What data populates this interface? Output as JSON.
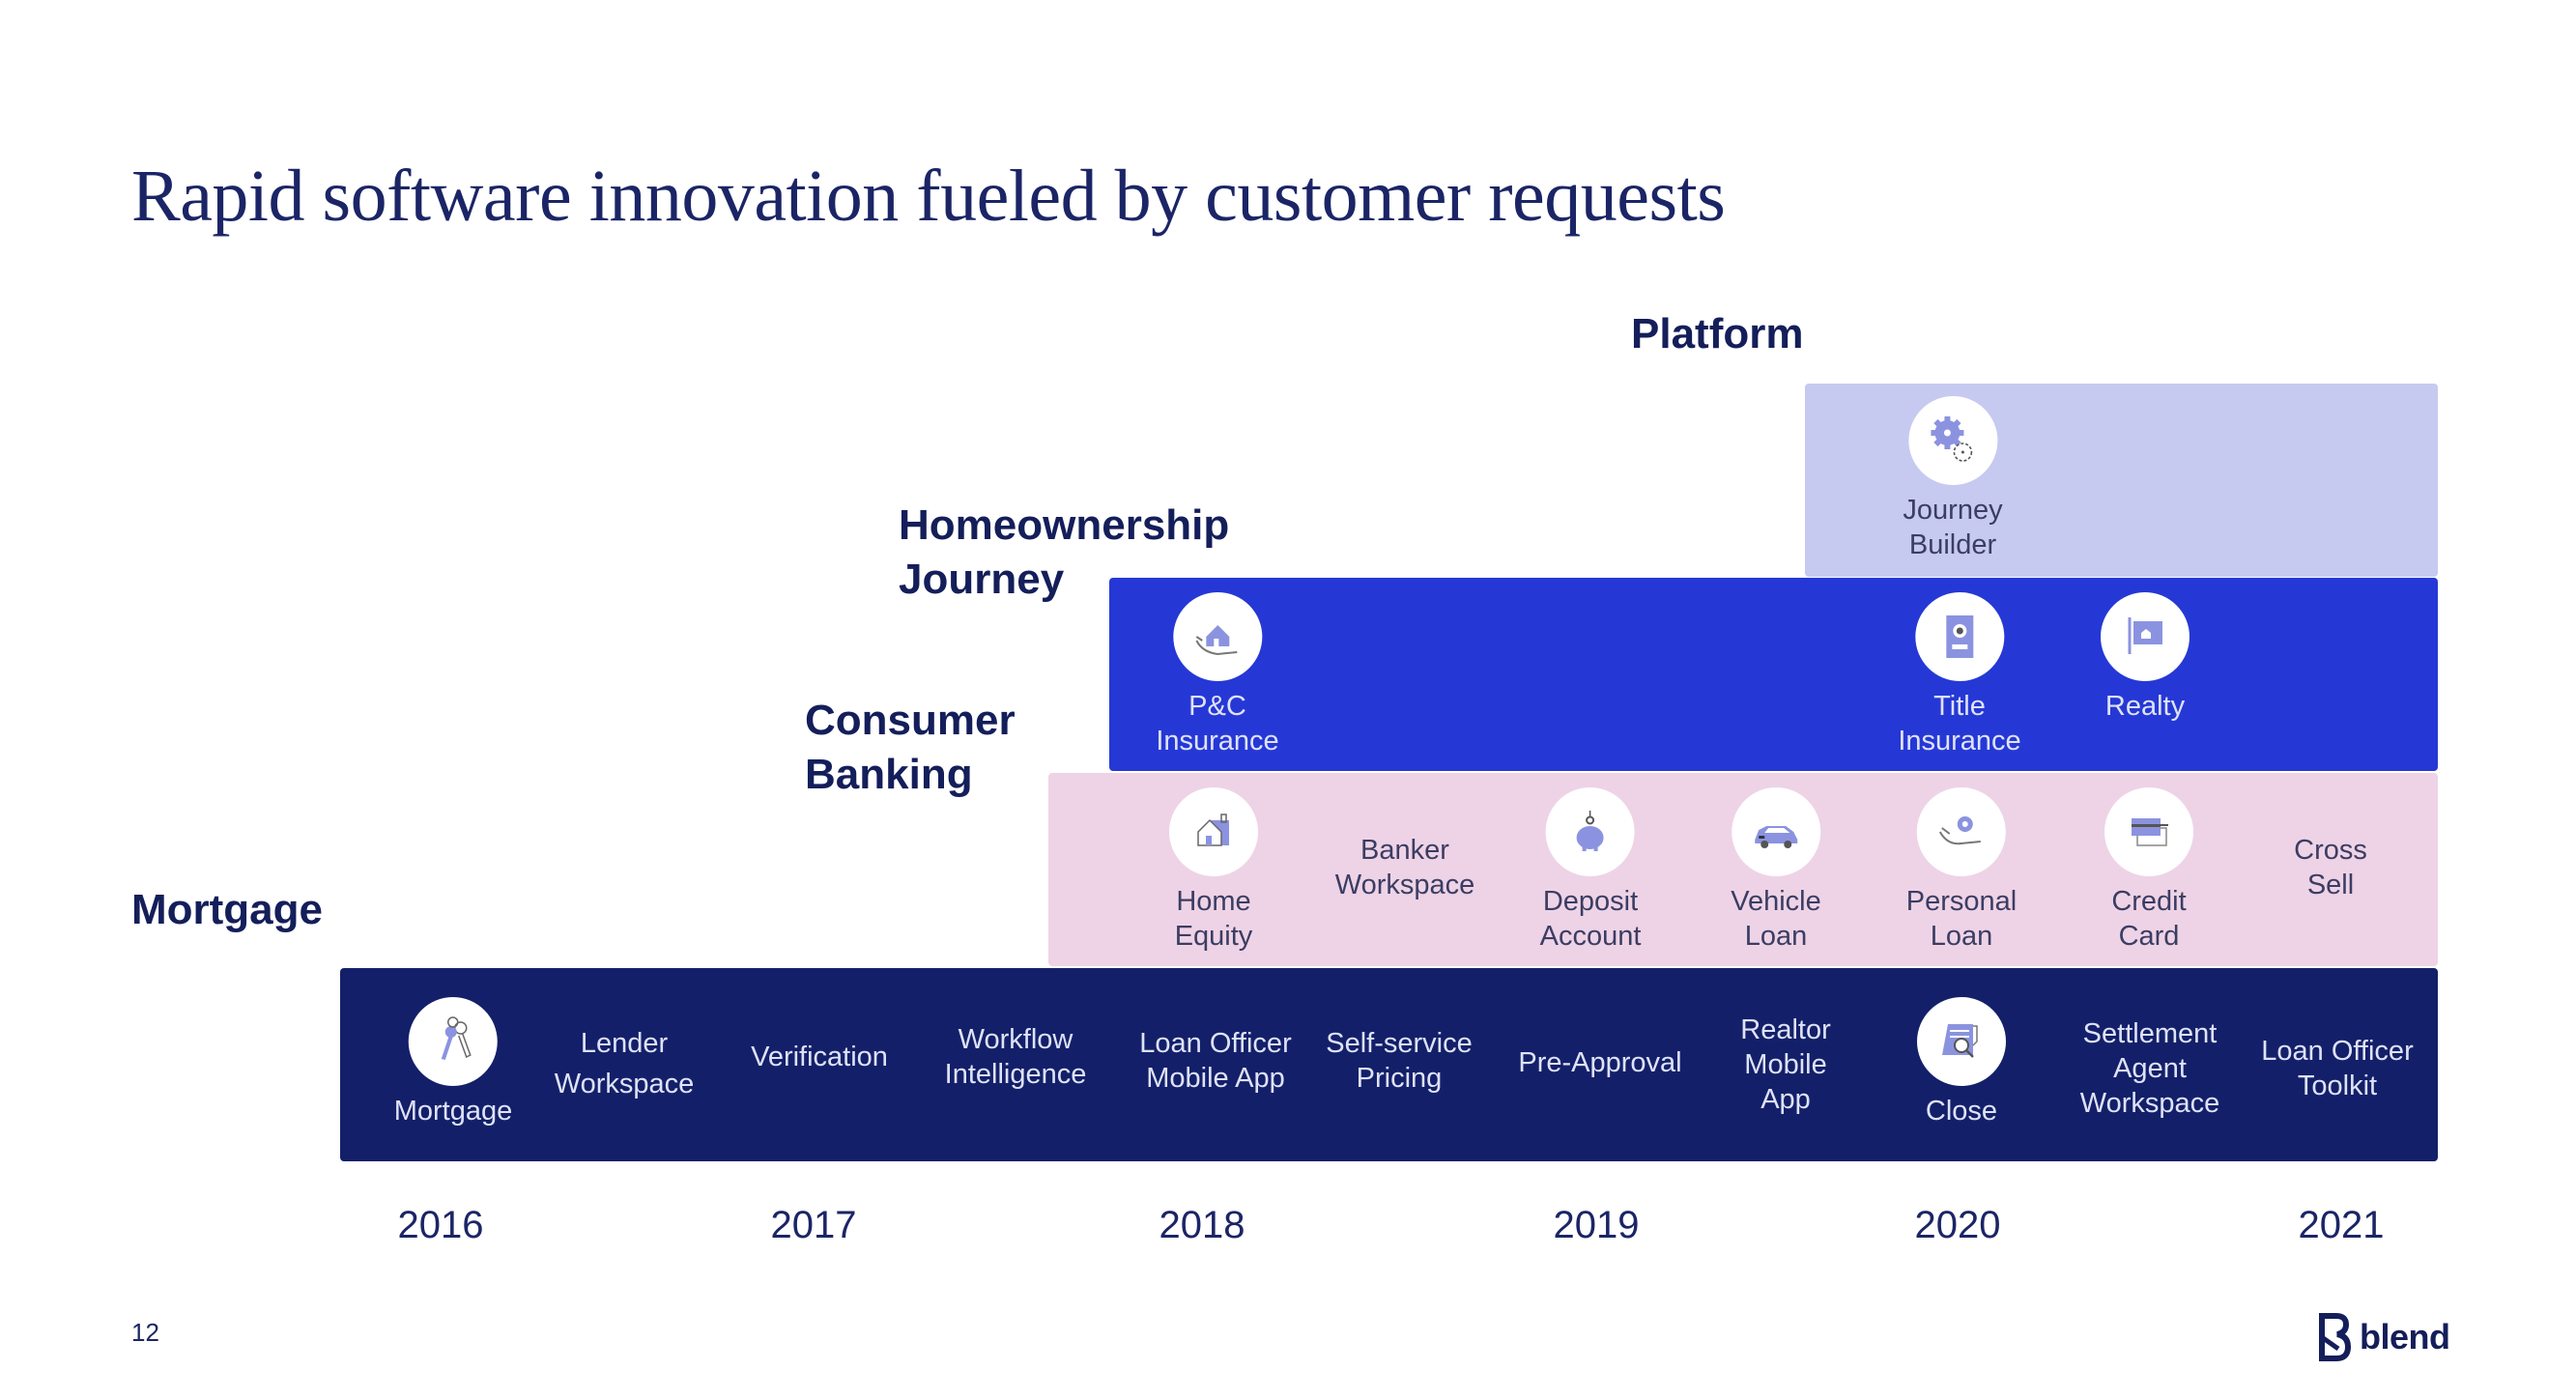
{
  "title": "Rapid software innovation fueled by customer requests",
  "categories": {
    "platform": "Platform",
    "homeownership_line1": "Homeownership",
    "homeownership_line2": "Journey",
    "consumer_line1": "Consumer",
    "consumer_line2": "Banking",
    "mortgage": "Mortgage"
  },
  "colors": {
    "navy": "#132069",
    "blue": "#2538d6",
    "pink": "#eed3e6",
    "lavender": "#c6caf0",
    "icon_accent": "#8b93e0",
    "text_dark": "#141e5a"
  },
  "bands": {
    "platform": {
      "items": [
        {
          "icon": "gears-icon",
          "line1": "Journey",
          "line2": "Builder"
        }
      ]
    },
    "homeownership": {
      "items": [
        {
          "icon": "house-in-hand-icon",
          "line1": "P&C",
          "line2": "Insurance"
        },
        {
          "icon": "certificate-icon",
          "line1": "Title",
          "line2": "Insurance"
        },
        {
          "icon": "realty-sign-icon",
          "line1": "Realty",
          "line2": ""
        }
      ]
    },
    "consumer": {
      "items": [
        {
          "icon": "house-icon",
          "line1": "Home",
          "line2": "Equity"
        },
        {
          "icon": "",
          "line1": "Banker",
          "line2": "Workspace"
        },
        {
          "icon": "piggy-bank-icon",
          "line1": "Deposit",
          "line2": "Account"
        },
        {
          "icon": "car-icon",
          "line1": "Vehicle",
          "line2": "Loan"
        },
        {
          "icon": "coin-in-hand-icon",
          "line1": "Personal",
          "line2": "Loan"
        },
        {
          "icon": "credit-card-icon",
          "line1": "Credit",
          "line2": "Card"
        },
        {
          "icon": "",
          "line1": "Cross",
          "line2": "Sell"
        }
      ]
    },
    "mortgage": {
      "items": [
        {
          "icon": "keys-icon",
          "line1": "Mortgage",
          "line2": ""
        },
        {
          "icon": "",
          "line1": "Lender",
          "line2": "Workspace"
        },
        {
          "icon": "",
          "line1": "Verification",
          "line2": ""
        },
        {
          "icon": "",
          "line1": "Workflow",
          "line2": "Intelligence"
        },
        {
          "icon": "",
          "line1": "Loan Officer",
          "line2": "Mobile App"
        },
        {
          "icon": "",
          "line1": "Self-service",
          "line2": "Pricing"
        },
        {
          "icon": "",
          "line1": "Pre-Approval",
          "line2": ""
        },
        {
          "icon": "",
          "line1": "Realtor",
          "line2": "Mobile",
          "line3": "App"
        },
        {
          "icon": "document-search-icon",
          "line1": "Close",
          "line2": ""
        },
        {
          "icon": "",
          "line1": "Settlement",
          "line2": "Agent",
          "line3": "Workspace"
        },
        {
          "icon": "",
          "line1": "Loan Officer",
          "line2": "Toolkit"
        }
      ]
    }
  },
  "years": [
    "2016",
    "2017",
    "2018",
    "2019",
    "2020",
    "2021"
  ],
  "footer": {
    "page_number": "12",
    "logo_text": "blend"
  }
}
